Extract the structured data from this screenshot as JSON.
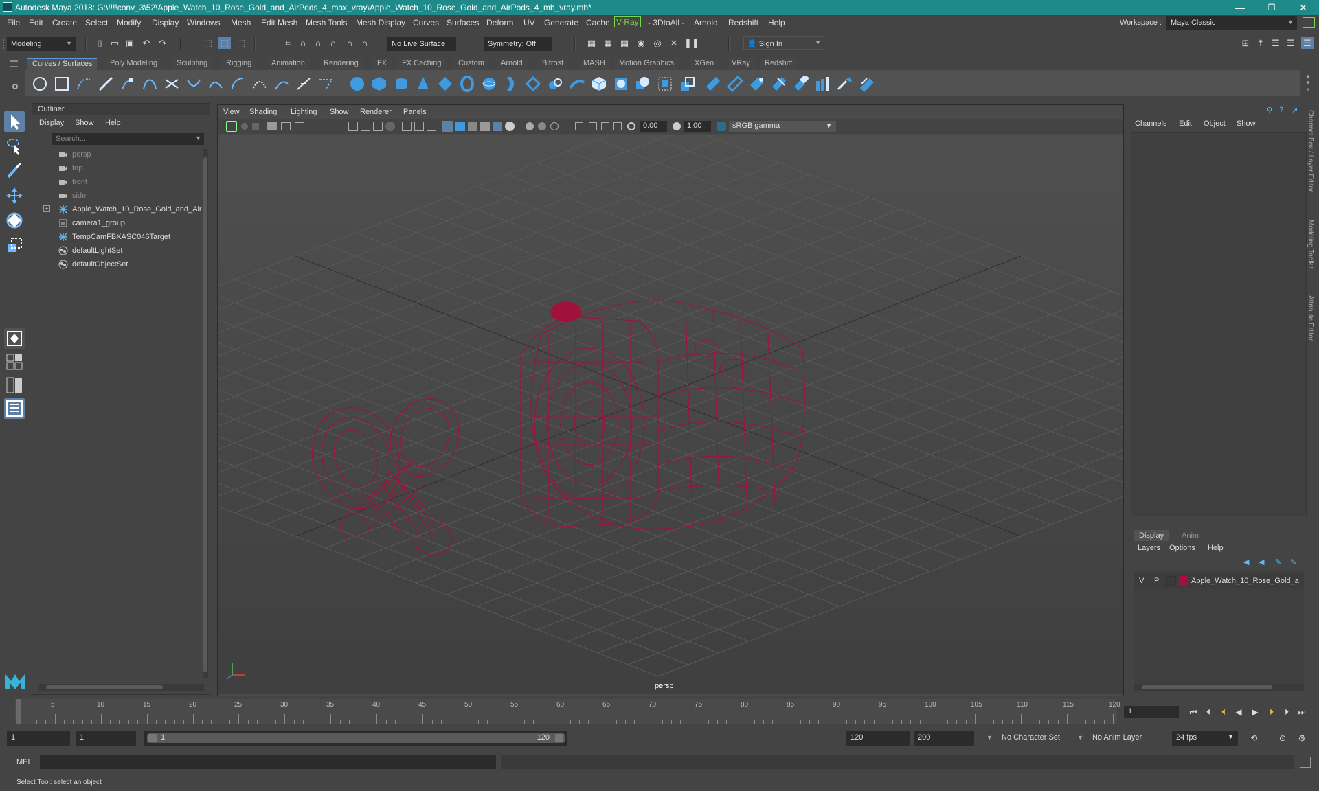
{
  "window": {
    "title": "Autodesk Maya 2018: G:\\!!!!conv_3\\52\\Apple_Watch_10_Rose_Gold_and_AirPods_4_max_vray\\Apple_Watch_10_Rose_Gold_and_AirPods_4_mb_vray.mb*",
    "minimize": "—",
    "maximize": "❐",
    "close": "✕"
  },
  "menubar": {
    "items": [
      "File",
      "Edit",
      "Create",
      "Select",
      "Modify",
      "Display",
      "Windows",
      "Mesh",
      "Edit Mesh",
      "Mesh Tools",
      "Mesh Display",
      "Curves",
      "Surfaces",
      "Deform",
      "UV",
      "Generate",
      "Cache",
      "V-Ray",
      "- 3DtoAll -",
      "Arnold",
      "Redshift",
      "Help"
    ],
    "workspace_label": "Workspace :",
    "workspace_value": "Maya Classic"
  },
  "statusline": {
    "menu_set": "Modeling",
    "live_surface": "No Live Surface",
    "symmetry": "Symmetry: Off",
    "sign_in": "Sign In"
  },
  "shelf": {
    "tabs": [
      "Curves / Surfaces",
      "Poly Modeling",
      "Sculpting",
      "Rigging",
      "Animation",
      "Rendering",
      "FX",
      "FX Caching",
      "Custom",
      "Arnold",
      "Bifrost",
      "MASH",
      "Motion Graphics",
      "XGen",
      "VRay",
      "Redshift"
    ],
    "active_tab": "Curves / Surfaces"
  },
  "outliner": {
    "title": "Outliner",
    "menus": [
      "Display",
      "Show",
      "Help"
    ],
    "search_placeholder": "Search...",
    "items": [
      {
        "label": "persp",
        "icon": "camera-icon",
        "dim": true
      },
      {
        "label": "top",
        "icon": "camera-icon",
        "dim": true
      },
      {
        "label": "front",
        "icon": "camera-icon",
        "dim": true
      },
      {
        "label": "side",
        "icon": "camera-icon",
        "dim": true
      },
      {
        "label": "Apple_Watch_10_Rose_Gold_and_Air",
        "icon": "transform-icon",
        "dim": false,
        "expandable": true
      },
      {
        "label": "camera1_group",
        "icon": "group-icon",
        "dim": false
      },
      {
        "label": "TempCamFBXASC046Target",
        "icon": "transform-icon",
        "dim": false
      },
      {
        "label": "defaultLightSet",
        "icon": "set-icon",
        "dim": false
      },
      {
        "label": "defaultObjectSet",
        "icon": "set-icon",
        "dim": false
      }
    ]
  },
  "viewport": {
    "menus": [
      "View",
      "Shading",
      "Lighting",
      "Show",
      "Renderer",
      "Panels"
    ],
    "exposure": "0.00",
    "gamma": "1.00",
    "color_space": "sRGB gamma",
    "camera_label": "persp",
    "wire_color": "#a0123a"
  },
  "channelbox": {
    "menus": [
      "Channels",
      "Edit",
      "Object",
      "Show"
    ],
    "side_tabs": [
      "Channel Box / Layer Editor",
      "Modeling Toolkit",
      "Attribute Editor"
    ]
  },
  "layers": {
    "tabs": [
      "Display",
      "Anim"
    ],
    "menus": [
      "Layers",
      "Options",
      "Help"
    ],
    "row": {
      "visible": "V",
      "playback": "P",
      "name": "Apple_Watch_10_Rose_Gold_a",
      "color": "#a0123a"
    }
  },
  "timeline": {
    "ticks": [
      "5",
      "10",
      "15",
      "20",
      "25",
      "30",
      "35",
      "40",
      "45",
      "50",
      "55",
      "60",
      "65",
      "70",
      "75",
      "80",
      "85",
      "90",
      "95",
      "100",
      "105",
      "110",
      "115",
      "120"
    ],
    "start_marker": "1",
    "current_frame": "1"
  },
  "range": {
    "start": "1",
    "playback_start": "1",
    "slider_start": "1",
    "slider_end": "120",
    "playback_end": "120",
    "end": "200",
    "character_set": "No Character Set",
    "anim_layer": "No Anim Layer",
    "fps": "24 fps"
  },
  "commandline": {
    "label": "MEL"
  },
  "helpline": {
    "text": "Select Tool: select an object"
  }
}
